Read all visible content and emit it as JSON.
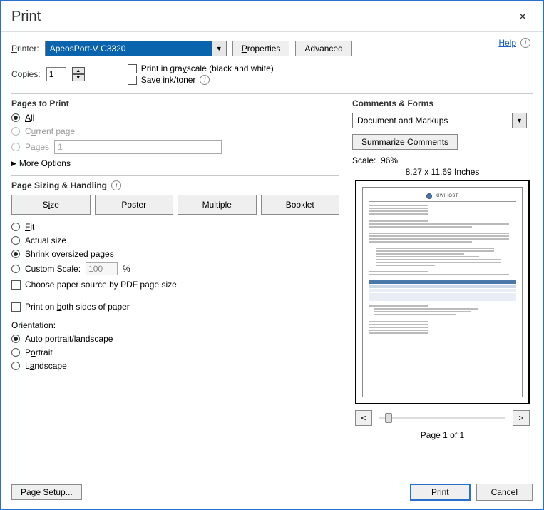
{
  "title": "Print",
  "printer_label": "Printer:",
  "printer_selected": "ApeosPort-V C3320",
  "properties_label": "Properties",
  "advanced_label": "Advanced",
  "help_label": "Help",
  "copies_label": "Copies:",
  "copies_value": "1",
  "grayscale_label": "Print in grayscale (black and white)",
  "save_ink_label": "Save ink/toner",
  "pages_to_print": {
    "heading": "Pages to Print",
    "all_label": "All",
    "current_label": "Current page",
    "pages_label": "Pages",
    "pages_value": "1",
    "more_options": "More Options"
  },
  "sizing": {
    "heading": "Page Sizing & Handling",
    "size": "Size",
    "poster": "Poster",
    "multiple": "Multiple",
    "booklet": "Booklet",
    "fit": "Fit",
    "actual": "Actual size",
    "shrink": "Shrink oversized pages",
    "custom": "Custom Scale:",
    "custom_value": "100",
    "percent": "%",
    "choose_source": "Choose paper source by PDF page size",
    "both_sides": "Print on both sides of paper"
  },
  "orientation": {
    "heading": "Orientation:",
    "auto": "Auto portrait/landscape",
    "portrait": "Portrait",
    "landscape": "Landscape"
  },
  "comments_forms": {
    "heading": "Comments & Forms",
    "selected": "Document and Markups",
    "summarize": "Summarize Comments"
  },
  "preview": {
    "scale_label": "Scale:",
    "scale_value": "96%",
    "dimensions": "8.27 x 11.69 Inches",
    "brand": "KIWIHOST",
    "page_of": "Page 1 of 1",
    "prev": "<",
    "next": ">"
  },
  "footer": {
    "page_setup": "Page Setup...",
    "print": "Print",
    "cancel": "Cancel"
  }
}
